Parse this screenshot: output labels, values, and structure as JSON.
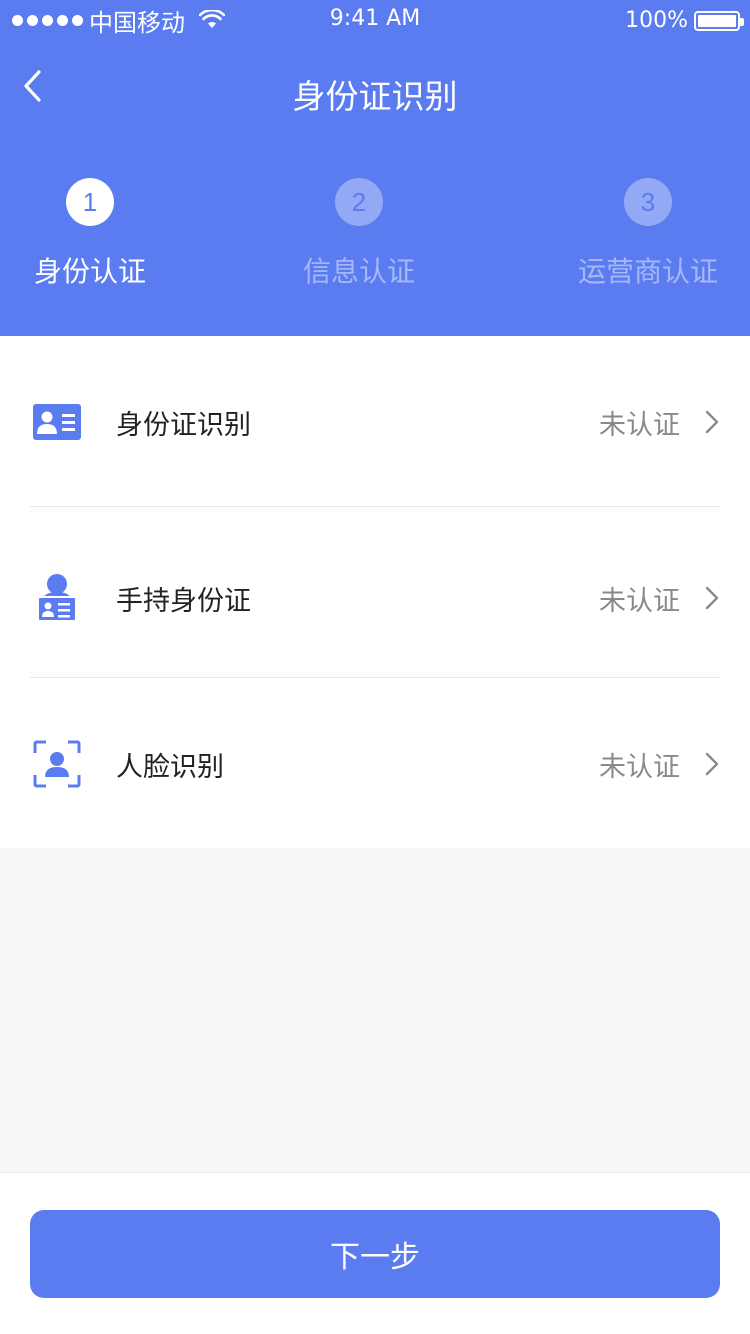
{
  "status_bar": {
    "carrier": "中国移动",
    "time": "9:41 AM",
    "battery": "100%"
  },
  "nav": {
    "title": "身份证识别",
    "back_icon": "chevron-left-icon"
  },
  "steps": [
    {
      "number": "1",
      "label": "身份认证",
      "state": "active"
    },
    {
      "number": "2",
      "label": "信息认证",
      "state": "inactive"
    },
    {
      "number": "3",
      "label": "运营商认证",
      "state": "inactive"
    }
  ],
  "items": [
    {
      "title": "身份证识别",
      "status": "未认证",
      "icon": "id-card-icon"
    },
    {
      "title": "手持身份证",
      "status": "未认证",
      "icon": "person-holding-id-icon"
    },
    {
      "title": "人脸识别",
      "status": "未认证",
      "icon": "face-scan-icon"
    }
  ],
  "next_button": {
    "label": "下一步"
  },
  "colors": {
    "primary": "#5b7cf0",
    "background": "#f5f6f8",
    "status_text": "#8a8a8a"
  }
}
